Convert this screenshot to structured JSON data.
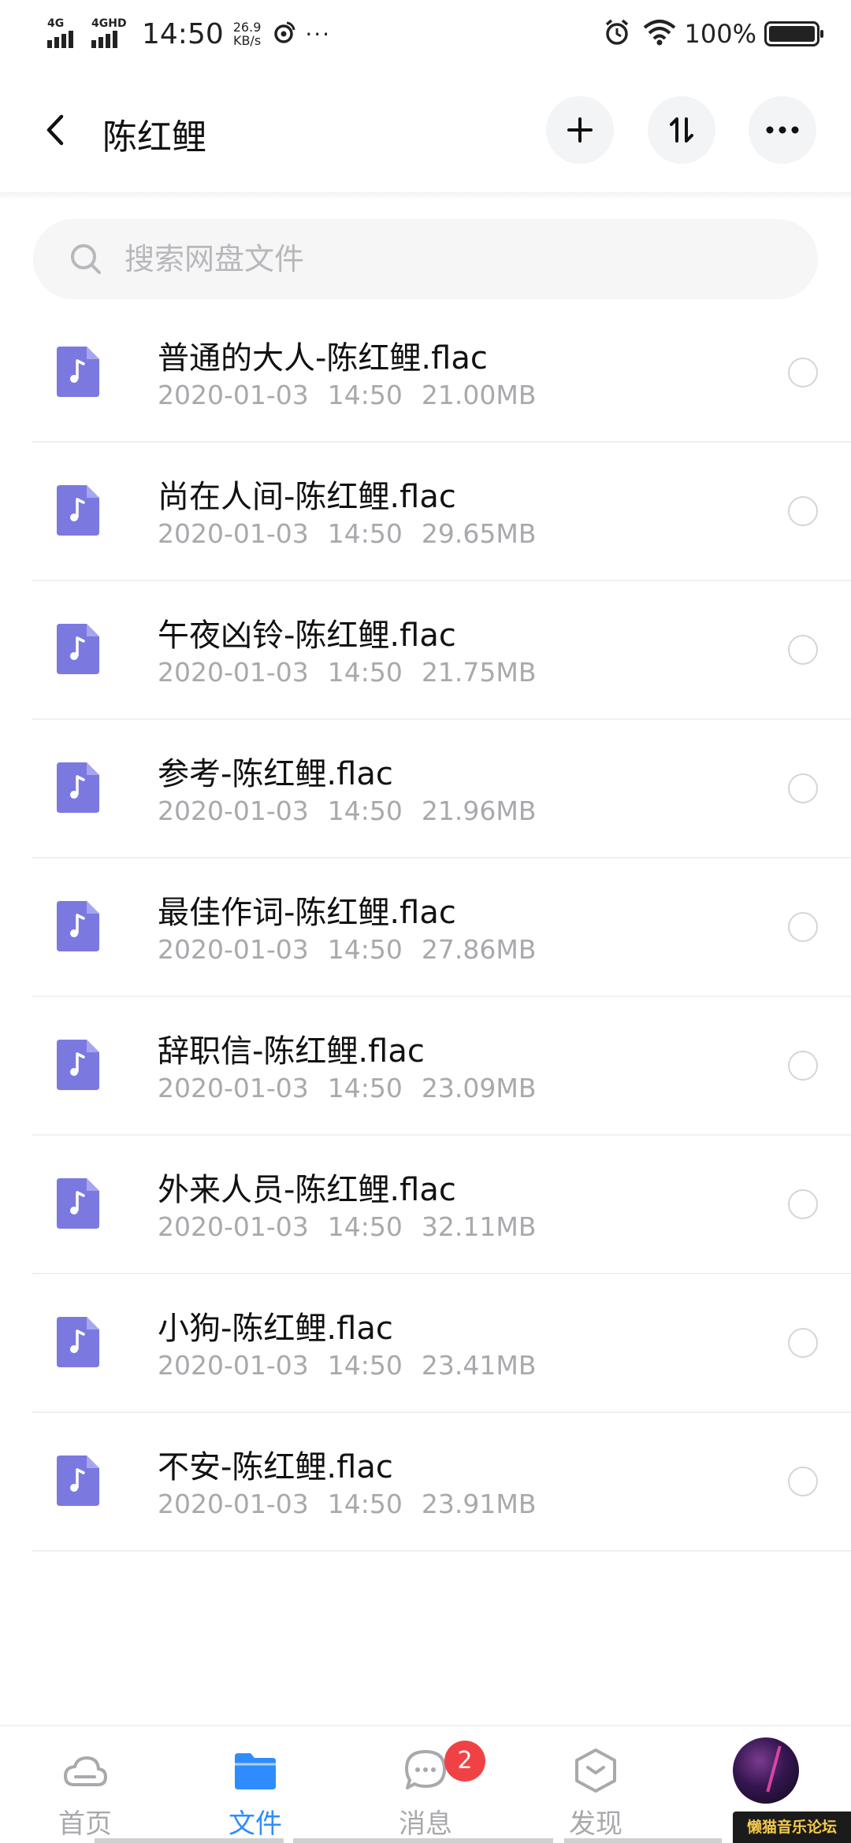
{
  "status_bar": {
    "sim1_label": "4G",
    "sim2_label": "4GHD",
    "time": "14:50",
    "speed_value": "26.9",
    "speed_unit": "KB/s",
    "overflow": "···",
    "battery_percent": "100%",
    "icons": [
      "signal-icon",
      "weibo-icon",
      "alarm-icon",
      "wifi-icon",
      "battery-icon"
    ]
  },
  "header": {
    "title": "陈红鲤",
    "buttons": [
      "back-icon",
      "add-icon",
      "sort-icon",
      "more-icon"
    ]
  },
  "search": {
    "placeholder": "搜索网盘文件"
  },
  "files": [
    {
      "name": "普通的大人-陈红鲤.flac",
      "date": "2020-01-03",
      "time": "14:50",
      "size": "21.00MB"
    },
    {
      "name": "尚在人间-陈红鲤.flac",
      "date": "2020-01-03",
      "time": "14:50",
      "size": "29.65MB"
    },
    {
      "name": "午夜凶铃-陈红鲤.flac",
      "date": "2020-01-03",
      "time": "14:50",
      "size": "21.75MB"
    },
    {
      "name": "参考-陈红鲤.flac",
      "date": "2020-01-03",
      "time": "14:50",
      "size": "21.96MB"
    },
    {
      "name": "最佳作词-陈红鲤.flac",
      "date": "2020-01-03",
      "time": "14:50",
      "size": "27.86MB"
    },
    {
      "name": "辞职信-陈红鲤.flac",
      "date": "2020-01-03",
      "time": "14:50",
      "size": "23.09MB"
    },
    {
      "name": "外来人员-陈红鲤.flac",
      "date": "2020-01-03",
      "time": "14:50",
      "size": "32.11MB"
    },
    {
      "name": "小狗-陈红鲤.flac",
      "date": "2020-01-03",
      "time": "14:50",
      "size": "23.41MB"
    },
    {
      "name": "不安-陈红鲤.flac",
      "date": "2020-01-03",
      "time": "14:50",
      "size": "23.91MB"
    }
  ],
  "bottom_nav": {
    "home_label": "首页",
    "files_label": "文件",
    "messages_label": "消息",
    "messages_badge": "2",
    "discover_label": "发现",
    "active": "files"
  },
  "watermark": "懒猫音乐论坛",
  "colors": {
    "accent": "#2f8cff",
    "file_icon": "#7b79e0",
    "badge": "#f04245",
    "muted_text": "#a9a9ad"
  }
}
